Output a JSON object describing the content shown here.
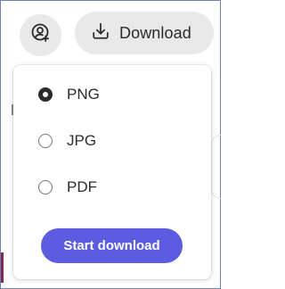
{
  "toolbar": {
    "share_icon": "person-location-icon",
    "download_icon": "download-tray-icon",
    "download_label": "Download"
  },
  "menu": {
    "options": [
      {
        "label": "PNG",
        "selected": true
      },
      {
        "label": "JPG",
        "selected": false
      },
      {
        "label": "PDF",
        "selected": false
      }
    ],
    "start_label": "Start download"
  },
  "colors": {
    "accent": "#5c5ce0",
    "button_bg": "#e9e9e9",
    "text": "#2c2c2c"
  }
}
